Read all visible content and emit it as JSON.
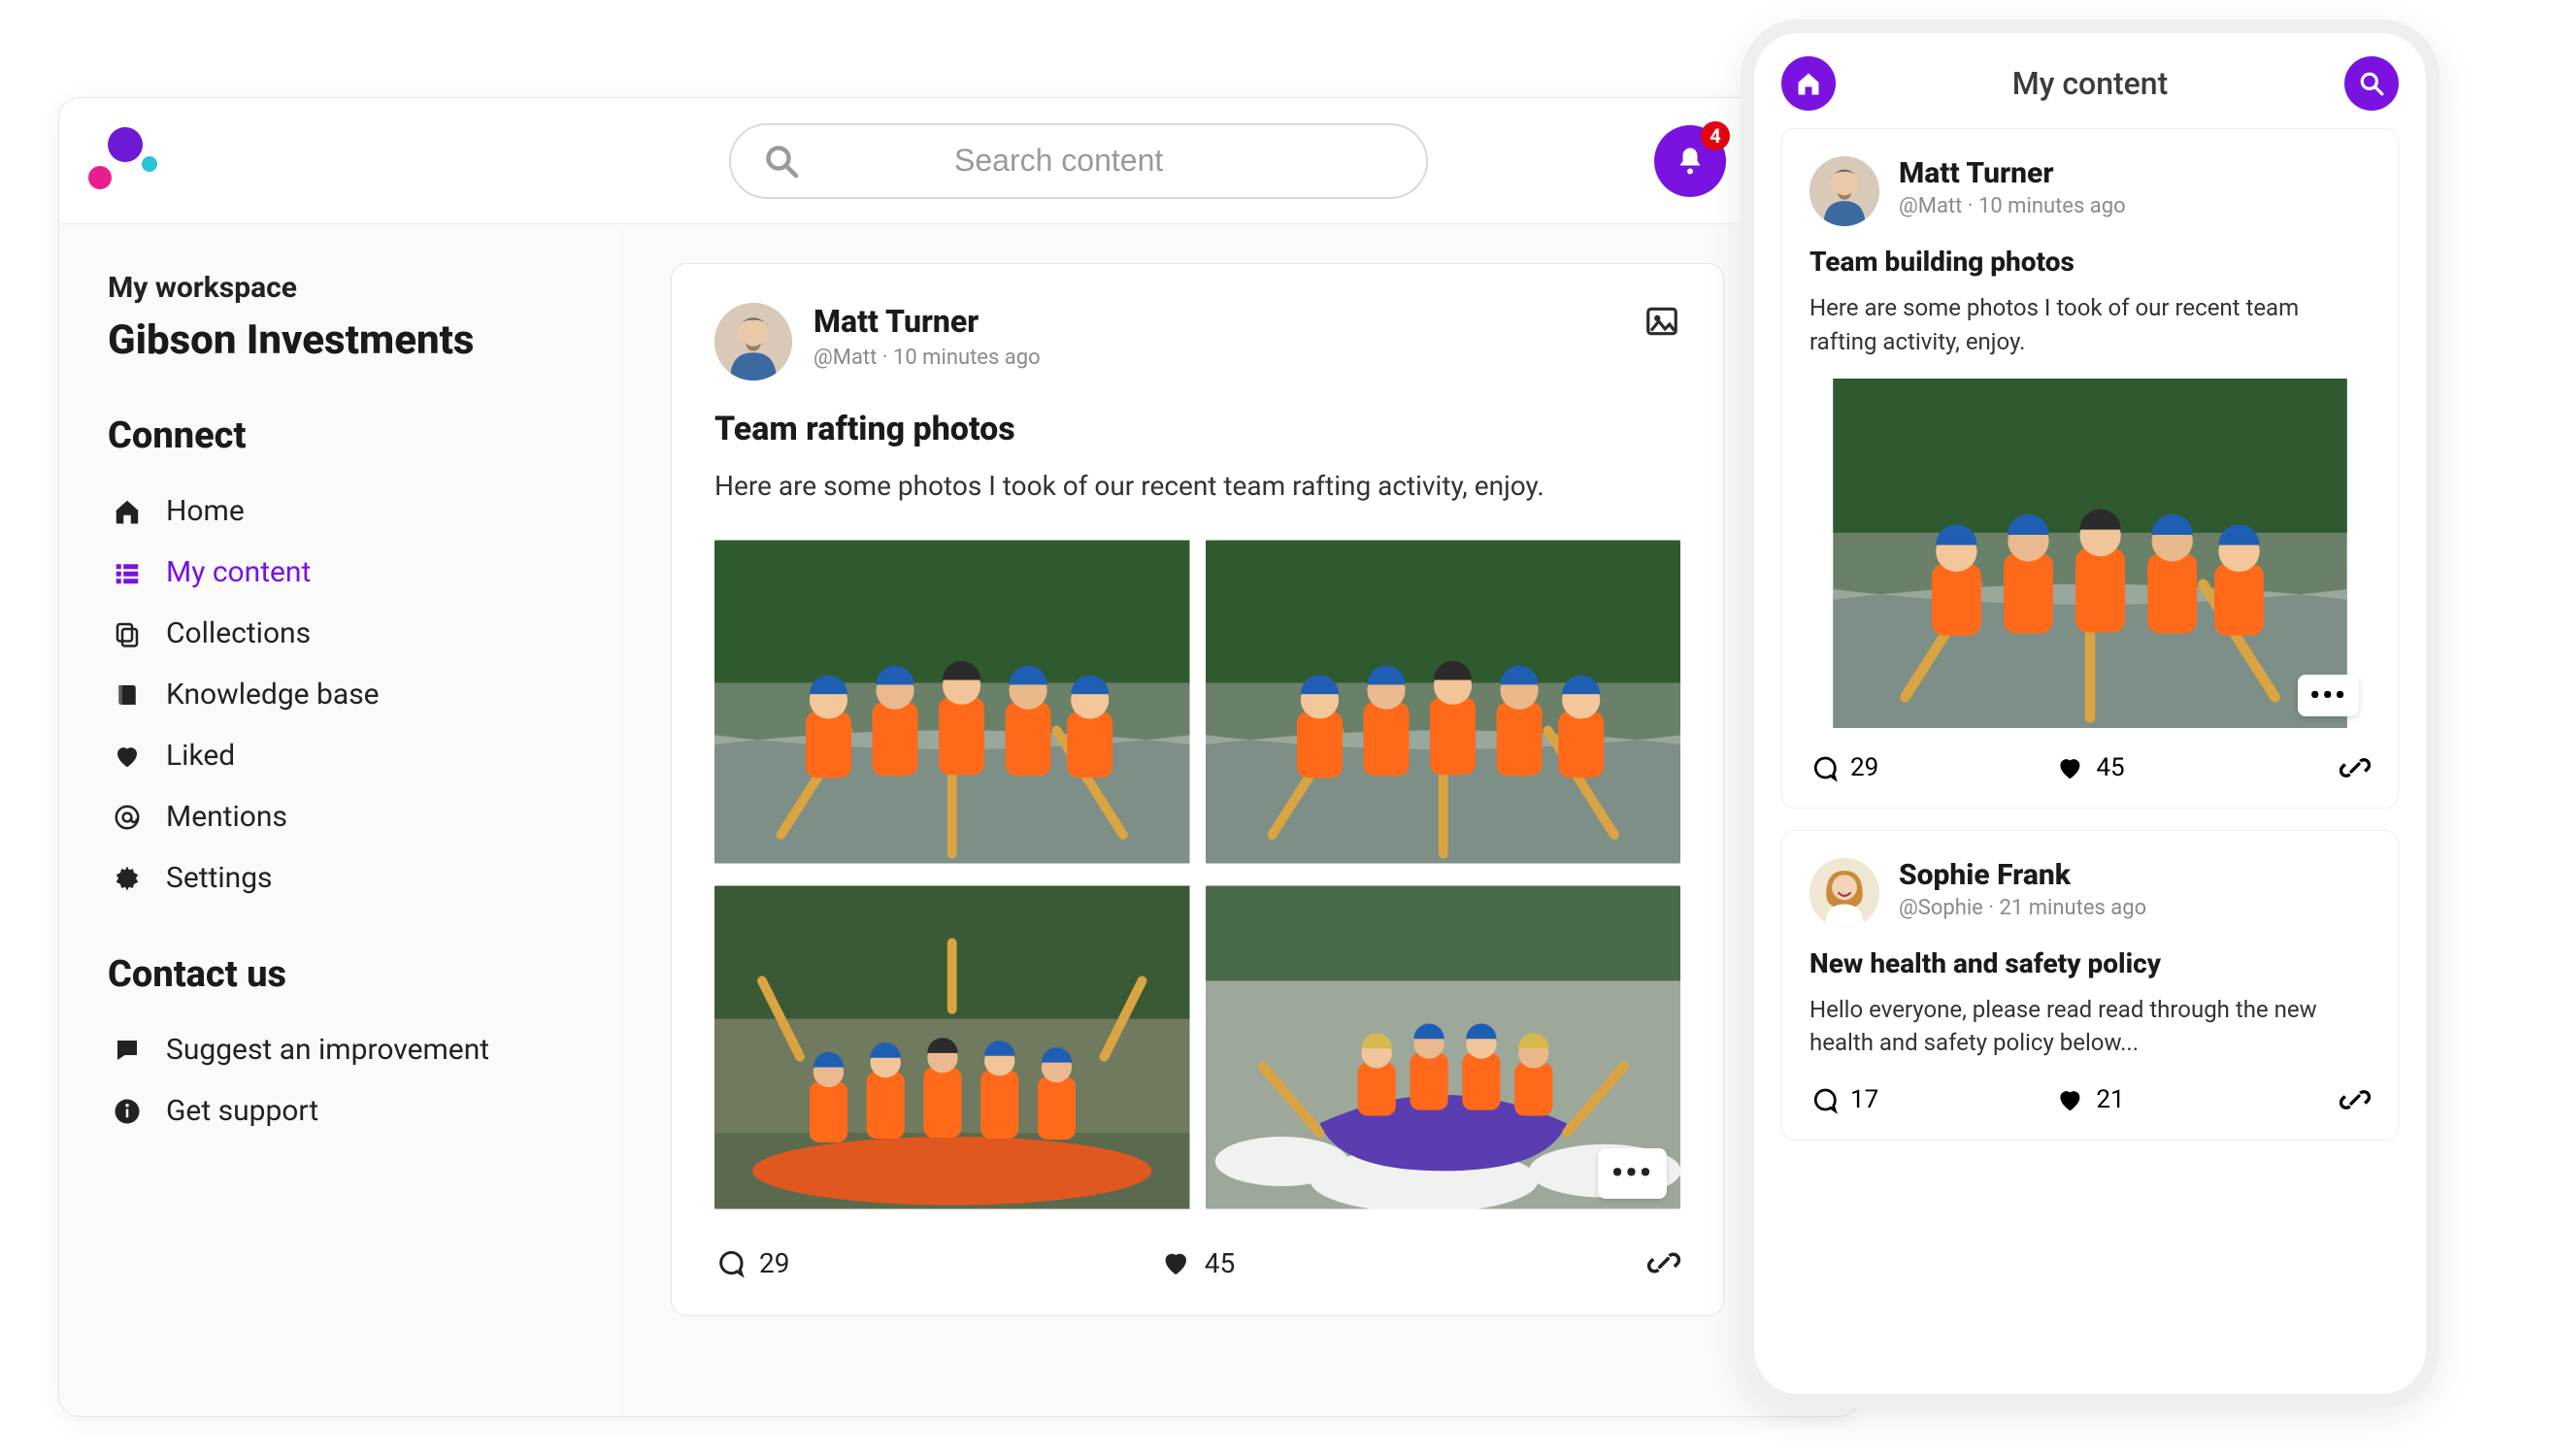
{
  "colors": {
    "accent": "#7a12e0",
    "badge": "#e30613"
  },
  "header": {
    "search_placeholder": "Search content",
    "notification_count": "4"
  },
  "sidebar": {
    "workspace_label": "My workspace",
    "workspace_name": "Gibson Investments",
    "section_connect": "Connect",
    "section_contact": "Contact us",
    "nav": {
      "home": "Home",
      "my_content": "My content",
      "collections": "Collections",
      "knowledge_base": "Knowledge base",
      "liked": "Liked",
      "mentions": "Mentions",
      "settings": "Settings"
    },
    "contact": {
      "suggest": "Suggest an improvement",
      "support": "Get support"
    }
  },
  "post": {
    "author_name": "Matt Turner",
    "author_meta": "@Matt · 10 minutes ago",
    "title": "Team rafting photos",
    "body": "Here are some photos I took of our recent team rafting activity, enjoy.",
    "comments": "29",
    "likes": "45",
    "more": "•••"
  },
  "mobile": {
    "header_title": "My content",
    "post1": {
      "author_name": "Matt Turner",
      "author_meta": "@Matt · 10 minutes ago",
      "title": "Team building photos",
      "body": "Here are some photos I took of our recent team rafting activity, enjoy.",
      "comments": "29",
      "likes": "45",
      "more": "•••"
    },
    "post2": {
      "author_name": "Sophie Frank",
      "author_meta": "@Sophie · 21 minutes ago",
      "title": "New health and safety policy",
      "body": "Hello everyone, please read read through the new health and safety policy below...",
      "comments": "17",
      "likes": "21"
    }
  }
}
